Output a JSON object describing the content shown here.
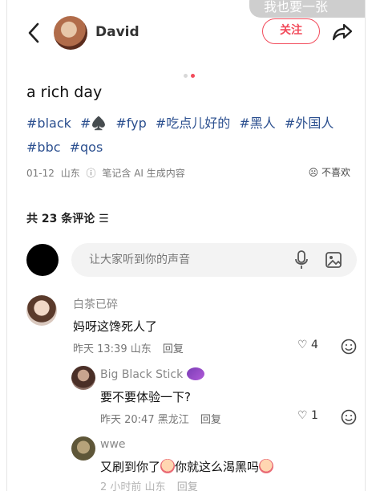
{
  "status_overlay": "我也要一张",
  "header": {
    "author": "David",
    "follow_label": "关注"
  },
  "post": {
    "title": "a rich day",
    "tags": [
      "#black",
      "#♠️",
      "#fyp",
      "#吃点儿好的",
      "#黑人",
      "#外国人",
      "#bbc",
      "#qos"
    ],
    "date": "01-12",
    "location": "山东",
    "ai_note": "笔记含 AI 生成内容",
    "dislike_label": "不喜欢"
  },
  "comments_header": "共 23 条评论",
  "comment_input": {
    "placeholder": "让大家听到你的声音"
  },
  "comments": [
    {
      "name": "白茶已碎",
      "text": "妈呀这馋死人了",
      "time": "昨天 13:39",
      "location": "山东",
      "reply_label": "回复",
      "likes": "4"
    },
    {
      "name": "Big Black Stick",
      "text": "要不要体验一下?",
      "time": "昨天 20:47",
      "location": "黑龙江",
      "reply_label": "回复",
      "likes": "1"
    },
    {
      "name": "wwe",
      "text_a": "又刷到你了",
      "text_b": "你就这么渴黑吗",
      "time": "2 小时前",
      "location": "山东",
      "reply_label": "回复"
    }
  ],
  "colors": {
    "accent": "#f24b5b",
    "tag_blue": "#2b4f8f"
  },
  "icons": [
    "back-icon",
    "share-icon",
    "mic-icon",
    "image-icon",
    "heart-icon",
    "smile-icon",
    "emoji-icon"
  ]
}
